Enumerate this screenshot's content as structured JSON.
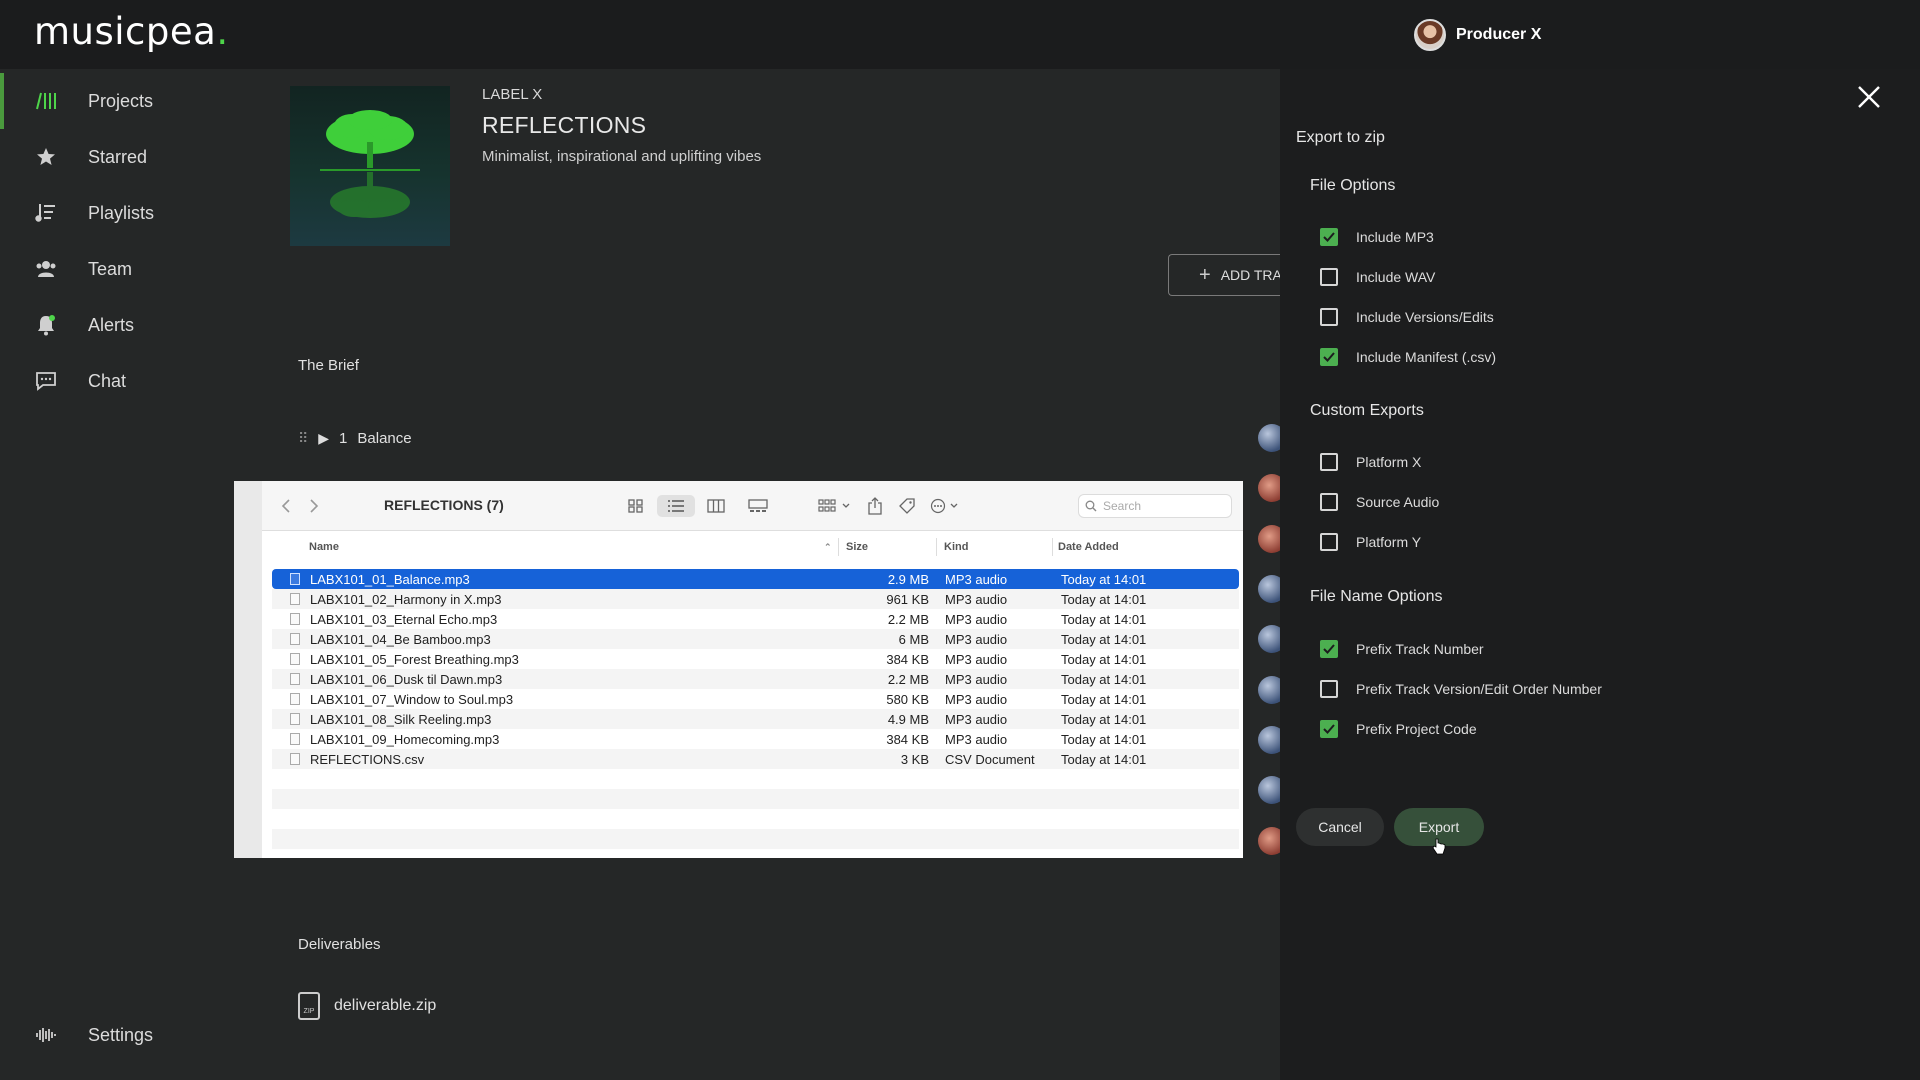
{
  "app": {
    "logo_text": "musicpea",
    "logo_dot": ".",
    "accent": "#4ed54a"
  },
  "user": {
    "name": "Producer X"
  },
  "sidebar": {
    "items": [
      {
        "label": "Projects",
        "icon": "projects-icon",
        "active": true
      },
      {
        "label": "Starred",
        "icon": "star-icon"
      },
      {
        "label": "Playlists",
        "icon": "playlist-icon"
      },
      {
        "label": "Team",
        "icon": "team-icon"
      },
      {
        "label": "Alerts",
        "icon": "bell-icon"
      },
      {
        "label": "Chat",
        "icon": "chat-icon"
      }
    ],
    "settings_label": "Settings"
  },
  "project": {
    "label": "LABEL X",
    "title": "REFLECTIONS",
    "description": "Minimalist, inspirational and uplifting vibes",
    "add_track_label": "ADD TRA",
    "brief_heading": "The Brief",
    "first_track": {
      "number": "1",
      "name": "Balance"
    },
    "deliverables_heading": "Deliverables",
    "deliverable_file": "deliverable.zip",
    "deliverable_icon_text": "ZIP"
  },
  "finder": {
    "title": "REFLECTIONS (7)",
    "search_placeholder": "Search",
    "columns": {
      "name": "Name",
      "size": "Size",
      "kind": "Kind",
      "date": "Date Added"
    },
    "files": [
      {
        "name": "LABX101_01_Balance.mp3",
        "size": "2.9 MB",
        "kind": "MP3 audio",
        "date": "Today at 14:01",
        "selected": true
      },
      {
        "name": "LABX101_02_Harmony in X.mp3",
        "size": "961 KB",
        "kind": "MP3 audio",
        "date": "Today at 14:01"
      },
      {
        "name": "LABX101_03_Eternal Echo.mp3",
        "size": "2.2 MB",
        "kind": "MP3 audio",
        "date": "Today at 14:01"
      },
      {
        "name": "LABX101_04_Be Bamboo.mp3",
        "size": "6 MB",
        "kind": "MP3 audio",
        "date": "Today at 14:01"
      },
      {
        "name": "LABX101_05_Forest Breathing.mp3",
        "size": "384 KB",
        "kind": "MP3 audio",
        "date": "Today at 14:01"
      },
      {
        "name": "LABX101_06_Dusk til Dawn.mp3",
        "size": "2.2 MB",
        "kind": "MP3 audio",
        "date": "Today at 14:01"
      },
      {
        "name": "LABX101_07_Window to Soul.mp3",
        "size": "580 KB",
        "kind": "MP3 audio",
        "date": "Today at 14:01"
      },
      {
        "name": "LABX101_08_Silk Reeling.mp3",
        "size": "4.9 MB",
        "kind": "MP3 audio",
        "date": "Today at 14:01"
      },
      {
        "name": "LABX101_09_Homecoming.mp3",
        "size": "384 KB",
        "kind": "MP3 audio",
        "date": "Today at 14:01"
      },
      {
        "name": "REFLECTIONS.csv",
        "size": "3 KB",
        "kind": "CSV Document",
        "date": "Today at 14:01"
      }
    ]
  },
  "export_panel": {
    "title": "Export to zip",
    "file_options": {
      "heading": "File Options",
      "items": [
        {
          "label": "Include MP3",
          "checked": true
        },
        {
          "label": "Include WAV",
          "checked": false
        },
        {
          "label": "Include Versions/Edits",
          "checked": false
        },
        {
          "label": "Include Manifest (.csv)",
          "checked": true
        }
      ]
    },
    "custom_exports": {
      "heading": "Custom Exports",
      "items": [
        {
          "label": "Platform X",
          "checked": false
        },
        {
          "label": "Source Audio",
          "checked": false
        },
        {
          "label": "Platform Y",
          "checked": false
        }
      ]
    },
    "file_name_options": {
      "heading": "File Name Options",
      "items": [
        {
          "label": "Prefix Track Number",
          "checked": true
        },
        {
          "label": "Prefix Track Version/Edit Order Number",
          "checked": false
        },
        {
          "label": "Prefix Project Code",
          "checked": true
        }
      ]
    },
    "cancel_label": "Cancel",
    "export_label": "Export"
  }
}
